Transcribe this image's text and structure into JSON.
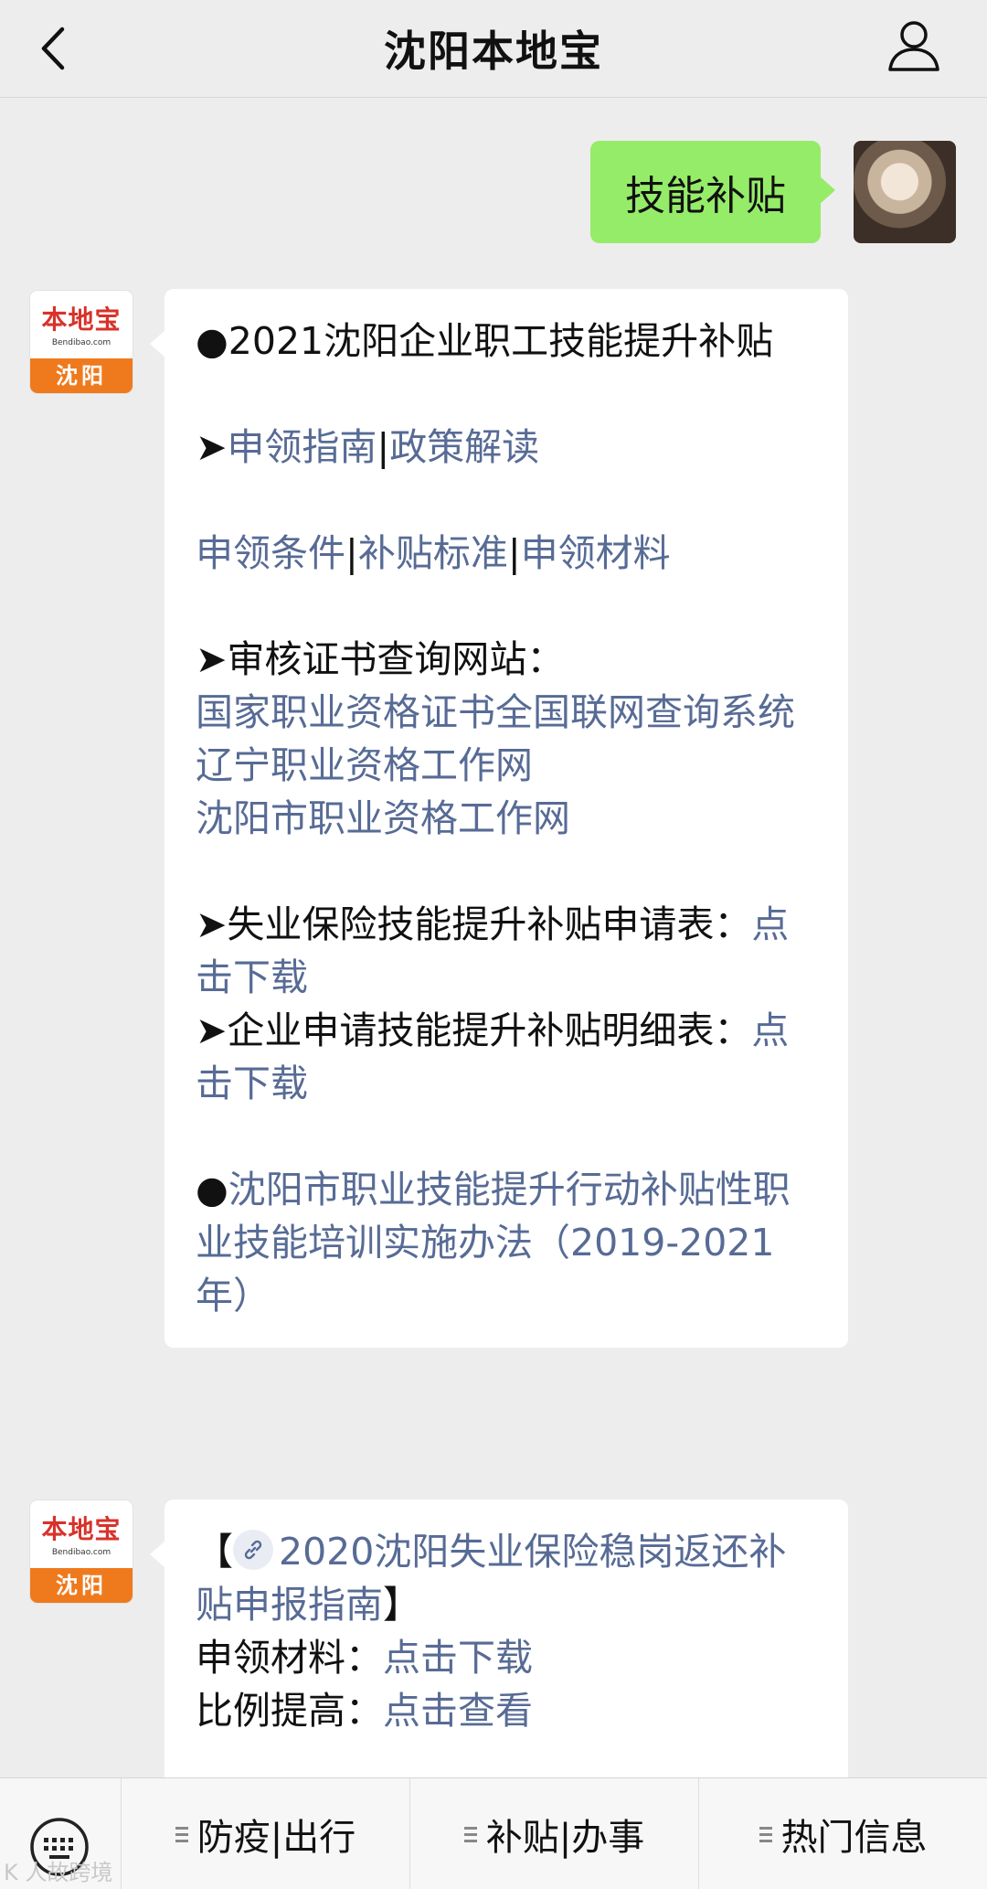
{
  "header": {
    "title": "沈阳本地宝"
  },
  "chat": {
    "user_message": "技能补贴",
    "bot_avatar": {
      "logo_text": "本地宝",
      "url_text": "Bendibao.com",
      "city": "沈阳"
    },
    "reply1": {
      "heading": "●2021沈阳企业职工技能提升补贴",
      "row1_prefix": "➤",
      "row1_link1": "申领指南",
      "row1_sep": "|",
      "row1_link2": "政策解读",
      "row2_link1": "申领条件",
      "row2_sep1": "|",
      "row2_link2": "补贴标准",
      "row2_sep2": "|",
      "row2_link3": "申领材料",
      "site_heading": "➤审核证书查询网站：",
      "site_link1": "国家职业资格证书全国联网查询系统",
      "site_link2": "辽宁职业资格工作网",
      "site_link3": "沈阳市职业资格工作网",
      "form1_text": "➤失业保险技能提升补贴申请表：",
      "form1_link": "点击下载",
      "form2_text": "➤企业申请技能提升补贴明细表：",
      "form2_link": "点击下载",
      "bullet": "●",
      "bottom_link": "沈阳市职业技能提升行动补贴性职业技能培训实施办法（2019-2021年）"
    },
    "reply2": {
      "open_bracket": "【",
      "link_title": "2020沈阳失业保险稳岗返还补贴申报指南",
      "close_bracket": "】",
      "line1_label": "申领材料：",
      "line1_link": "点击下载",
      "line2_label": "比例提高：",
      "line2_link": "点击查看"
    }
  },
  "menu": {
    "items": [
      "防疫|出行",
      "补贴|办事",
      "热门信息"
    ]
  },
  "watermark": "K 人故跨境"
}
